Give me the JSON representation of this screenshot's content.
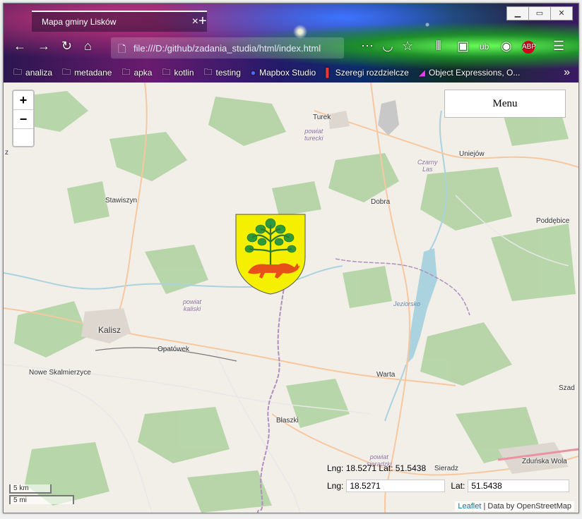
{
  "browser": {
    "tab_title": "Mapa gminy Lisków",
    "url": "file:///D:/github/zadania_studia/html/index.html",
    "bookmarks": [
      "analiza",
      "metadane",
      "apka",
      "kotlin",
      "testing",
      "Mapbox Studio",
      "Szeregi rozdzielcze",
      "Object Expressions, O..."
    ]
  },
  "map": {
    "zoom_in": "+",
    "zoom_out": "−",
    "menu_label": "Menu",
    "places": {
      "turek": "Turek",
      "uniejow": "Uniejów",
      "stawiszyn": "Stawiszyn",
      "dobra": "Dobra",
      "poddebice": "Poddębice",
      "kalisz": "Kalisz",
      "opatowek": "Opatówek",
      "nowe_skalmierzyce": "Nowe Skalmierzyce",
      "warta": "Warta",
      "blaszki": "Błaszki",
      "sieradz": "Sieradz",
      "zdunska_wola": "Zduńska Wola",
      "szad": "Szad",
      "z": "z"
    },
    "districts": {
      "turecki": "powiat\nturecki",
      "kaliski": "powiat\nkaliski",
      "sieradzki": "powiat\nsieradzki",
      "czarny_las": "Czarny\nLas"
    },
    "lake": "Jeziorsko",
    "coords_text": "Lng: 18.5271 Lat: 51.5438",
    "lng_label": "Lng:",
    "lng_value": "18.5271",
    "lat_label": "Lat:",
    "lat_value": "51.5438",
    "scale_km": "5 km",
    "scale_mi": "5 mi",
    "attribution_link": "Leaflet",
    "attribution_text": " | Data by OpenStreetMap"
  }
}
